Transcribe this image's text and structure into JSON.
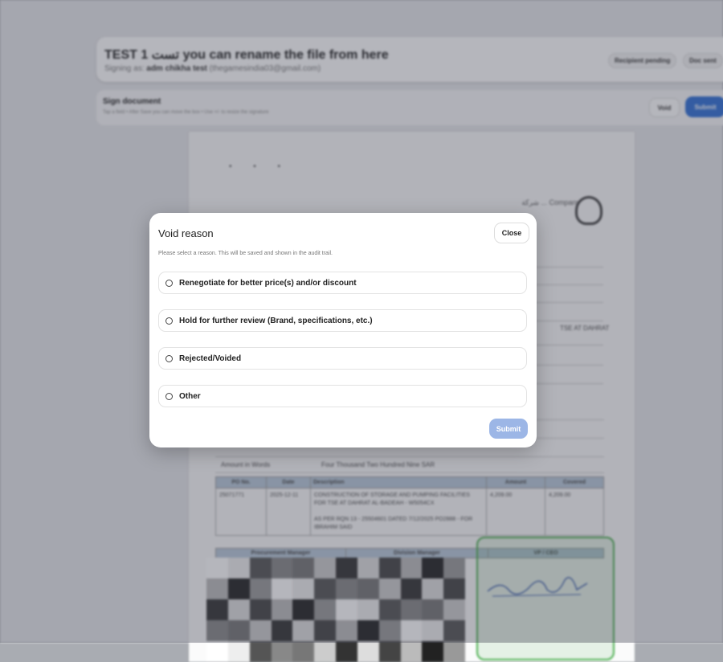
{
  "header": {
    "doc_title": "TEST 1 تست you can rename the file from here",
    "signing_as_label": "Signing as:",
    "signer_name": "adm chikha test",
    "signer_email": "(thegamesindia03@gmail.com)",
    "status_recipient": "Recipient pending",
    "status_doc": "Doc sent"
  },
  "sign_bar": {
    "title": "Sign document",
    "hint": "Tap a field • After Save you can move the box • Use +/- to resize the signature",
    "void_label": "Void",
    "submit_label": "Submit"
  },
  "document": {
    "logo_text": "شركة ... Company",
    "amount_in_words_label": "Amount in Words",
    "amount_in_words_value": "Four Thousand Two Hundred Nine SAR",
    "snippet_right": "TSE AT DAHRAT",
    "po_headers": [
      "PO No.",
      "Date",
      "Description",
      "Amount",
      "Covered"
    ],
    "po_row": {
      "po_no": "25071771",
      "date": "2025-12-11",
      "description": "CONSTRUCTION OF STORAGE AND PUMPING FACILITIES FOR TSE AT DAHRAT AL-BADEAH - W5054CX",
      "description2": "AS PER RQN 13 - 25504601 DATED 7/12/2025 PO2888 - FOR IBRAHIM SAID",
      "amount": "4,209.00",
      "covered": "4,209.00"
    },
    "sig_headers": [
      "Procurement Manager",
      "Division Manager",
      "VP / CEO"
    ]
  },
  "modal": {
    "title": "Void reason",
    "close_label": "Close",
    "description": "Please select a reason. This will be saved and shown in the audit trail.",
    "options": [
      "Renegotiate for better price(s) and/or discount",
      "Hold for further review (Brand, specifications, etc.)",
      "Rejected/Voided",
      "Other"
    ],
    "submit_label": "Submit"
  },
  "colors": {
    "primary": "#2f6fd6",
    "primary_disabled": "#9cb6e6",
    "signature_box": "#4caf50"
  }
}
